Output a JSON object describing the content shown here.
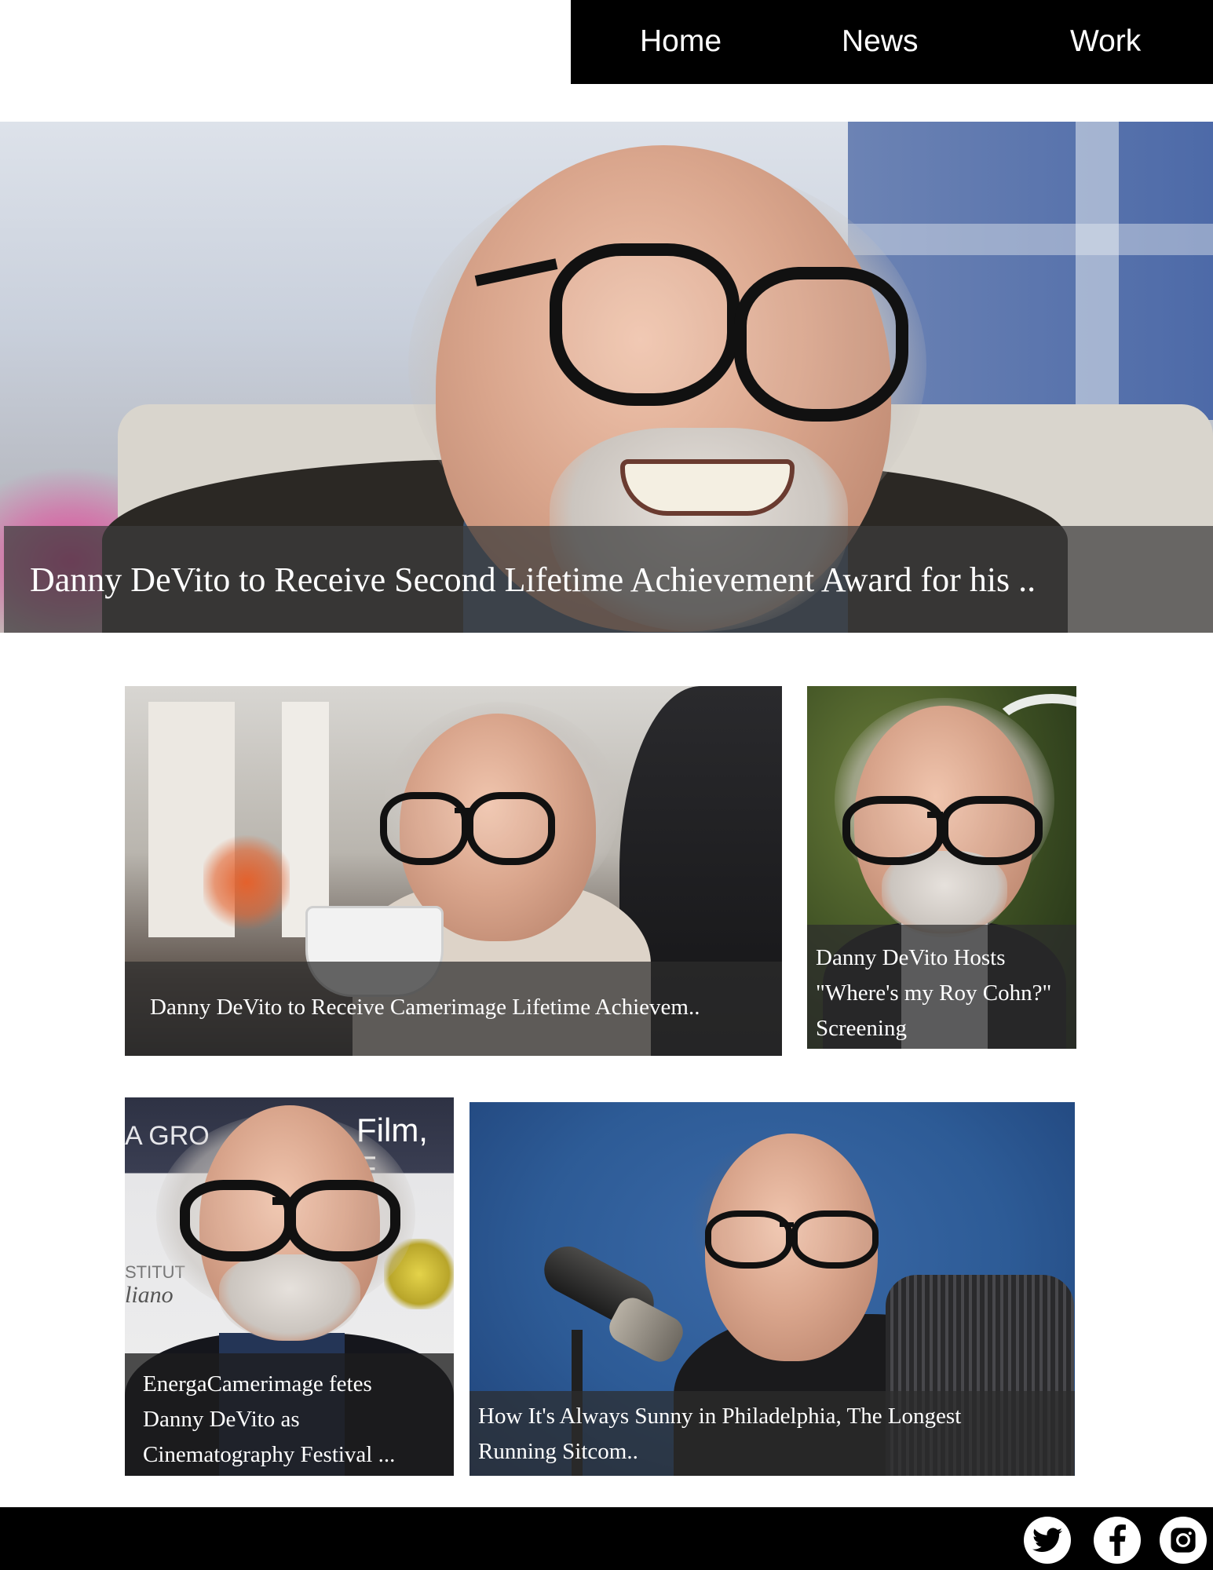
{
  "nav": {
    "items": [
      {
        "label": "Home"
      },
      {
        "label": "News"
      },
      {
        "label": "Work"
      }
    ]
  },
  "hero": {
    "caption": "Danny DeVito to Receive Second Lifetime Achievement Award for his .."
  },
  "cards": [
    {
      "caption": "Danny DeVito to Receive Camerimage Lifetime Achievem.."
    },
    {
      "caption_lines": [
        "Danny DeVito Hosts",
        "\"Where's my Roy Cohn?\"",
        "Screening"
      ]
    },
    {
      "caption_lines": [
        "EnergaCamerimage fetes",
        "Danny DeVito as",
        "Cinematography Festival ..."
      ],
      "backdrop_text": [
        "A GRO",
        "Film, F",
        "STITUT",
        "liano"
      ]
    },
    {
      "caption_lines": [
        "How It's Always Sunny in Philadelphia, The Longest",
        "Running Sitcom.."
      ]
    }
  ],
  "footer": {
    "social": [
      {
        "icon": "twitter-icon"
      },
      {
        "icon": "facebook-icon"
      },
      {
        "icon": "instagram-icon"
      }
    ]
  }
}
